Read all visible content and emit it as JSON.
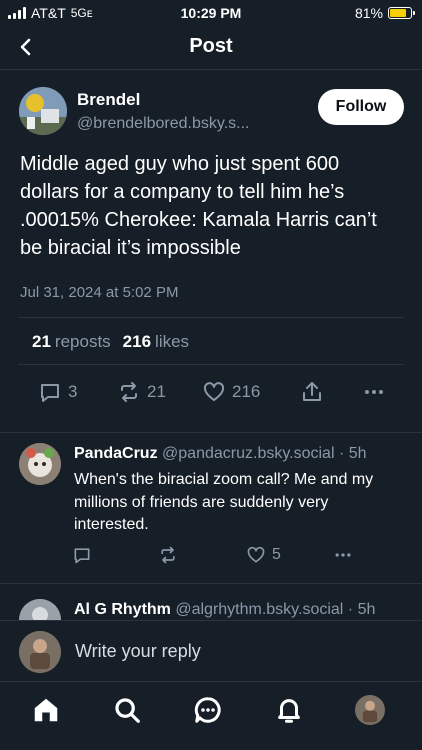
{
  "status_bar": {
    "carrier": "AT&T",
    "network": "5Gᴇ",
    "time": "10:29 PM",
    "battery": "81%",
    "battery_level": 0.81
  },
  "header": {
    "title": "Post"
  },
  "post": {
    "author_name": "Brendel",
    "author_handle": "@brendelbored.bsky.s...",
    "follow_label": "Follow",
    "text": "Middle aged guy who just spent 600 dollars for a company to tell him he’s .00015% Cherokee: Kamala Harris can’t be biracial it’s impossible",
    "date": "Jul 31, 2024 at 5:02 PM",
    "reposts_count": "21",
    "reposts_label": "reposts",
    "likes_count": "216",
    "likes_label": "likes",
    "actions": {
      "replies": "3",
      "reposts": "21",
      "likes": "216"
    }
  },
  "reply": {
    "author_name": "PandaCruz",
    "author_handle": "@pandacruz.bsky.social · 5h",
    "text": "When's the biracial zoom call? Me and my millions of friends are suddenly very interested.",
    "actions": {
      "likes": "5"
    }
  },
  "reply2": {
    "author_name": "Al G Rhythm",
    "author_handle": "@algrhythm.bsky.social · 5h"
  },
  "composer": {
    "placeholder": "Write your reply"
  },
  "colors": {
    "background": "#161e27",
    "muted": "#8a98a8",
    "divider": "#2a3440",
    "battery": "#f5d000"
  }
}
